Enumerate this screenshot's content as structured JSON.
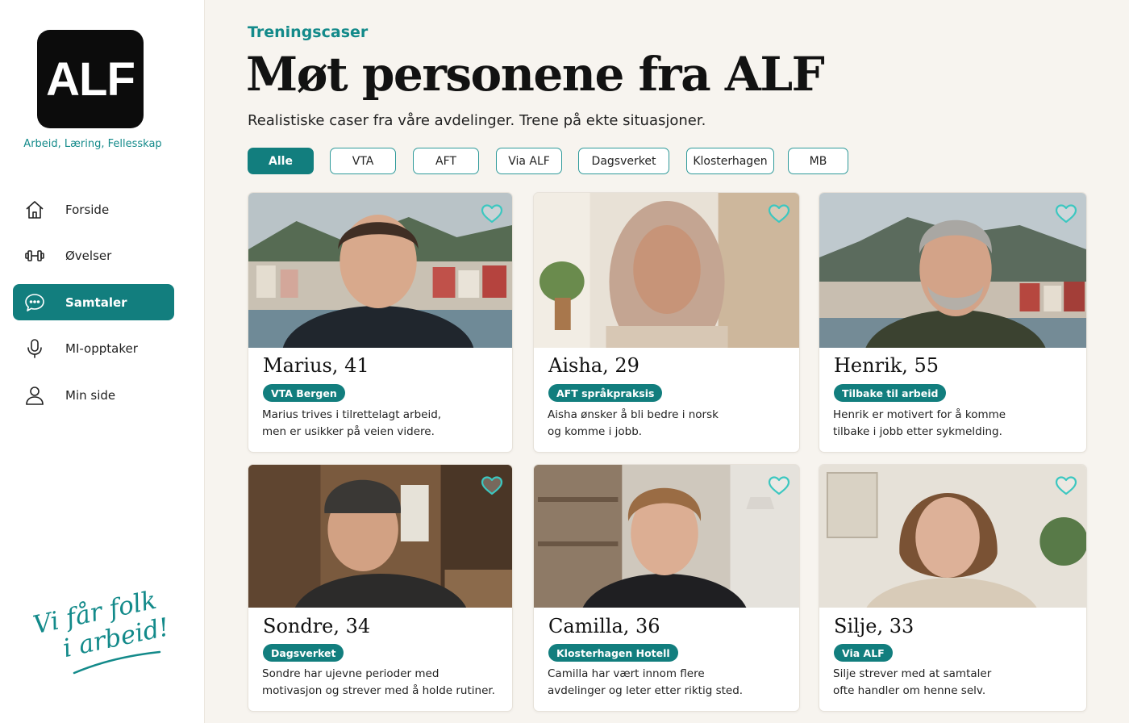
{
  "sidebar": {
    "logo_text": "ALF",
    "tagline": "Arbeid, Læring, Fellesskap",
    "nav": [
      {
        "label": "Forside",
        "icon": "home-icon"
      },
      {
        "label": "Øvelser",
        "icon": "dumbbell-icon"
      },
      {
        "label": "Samtaler",
        "icon": "chat-icon",
        "active": true
      },
      {
        "label": "MI-opptaker",
        "icon": "microphone-icon"
      },
      {
        "label": "Min side",
        "icon": "user-icon"
      }
    ],
    "slogan_line1": "Vi får folk",
    "slogan_line2": "i arbeid!"
  },
  "main": {
    "eyebrow": "Treningscaser",
    "title": "Møt personene fra ALF",
    "subtitle": "Realistiske caser fra våre avdelinger. Trene på ekte situasjoner.",
    "filters": [
      "Alle",
      "VTA",
      "AFT",
      "Via ALF",
      "Dagsverket",
      "Klosterhagen",
      "MB"
    ],
    "active_filter": "Alle"
  },
  "cards": [
    {
      "name": "Marius, 41",
      "badge": "VTA Bergen",
      "desc1": "Marius trives i tilrettelagt arbeid,",
      "desc2": "men er usikker på veien videre."
    },
    {
      "name": "Aisha, 29",
      "badge": "AFT språkpraksis",
      "desc1": "Aisha ønsker å bli bedre i norsk",
      "desc2": "og komme i jobb."
    },
    {
      "name": "Henrik, 55",
      "badge": "Tilbake til arbeid",
      "desc1": "Henrik er motivert for å komme",
      "desc2": "tilbake i jobb etter sykmelding."
    },
    {
      "name": "Sondre, 34",
      "badge": "Dagsverket",
      "desc1": "Sondre har ujevne perioder med",
      "desc2": "motivasjon og strever med å holde rutiner."
    },
    {
      "name": "Camilla, 36",
      "badge": "Klosterhagen Hotell",
      "desc1": "Camilla har vært innom flere",
      "desc2": "avdelinger og leter etter riktig sted."
    },
    {
      "name": "Silje, 33",
      "badge": "Via ALF",
      "desc1": "Silje strever med at samtaler",
      "desc2": "ofte handler om henne selv."
    }
  ],
  "colors": {
    "accent": "#127e7e",
    "accent_text": "#138a8a",
    "background": "#f7f4ef"
  }
}
